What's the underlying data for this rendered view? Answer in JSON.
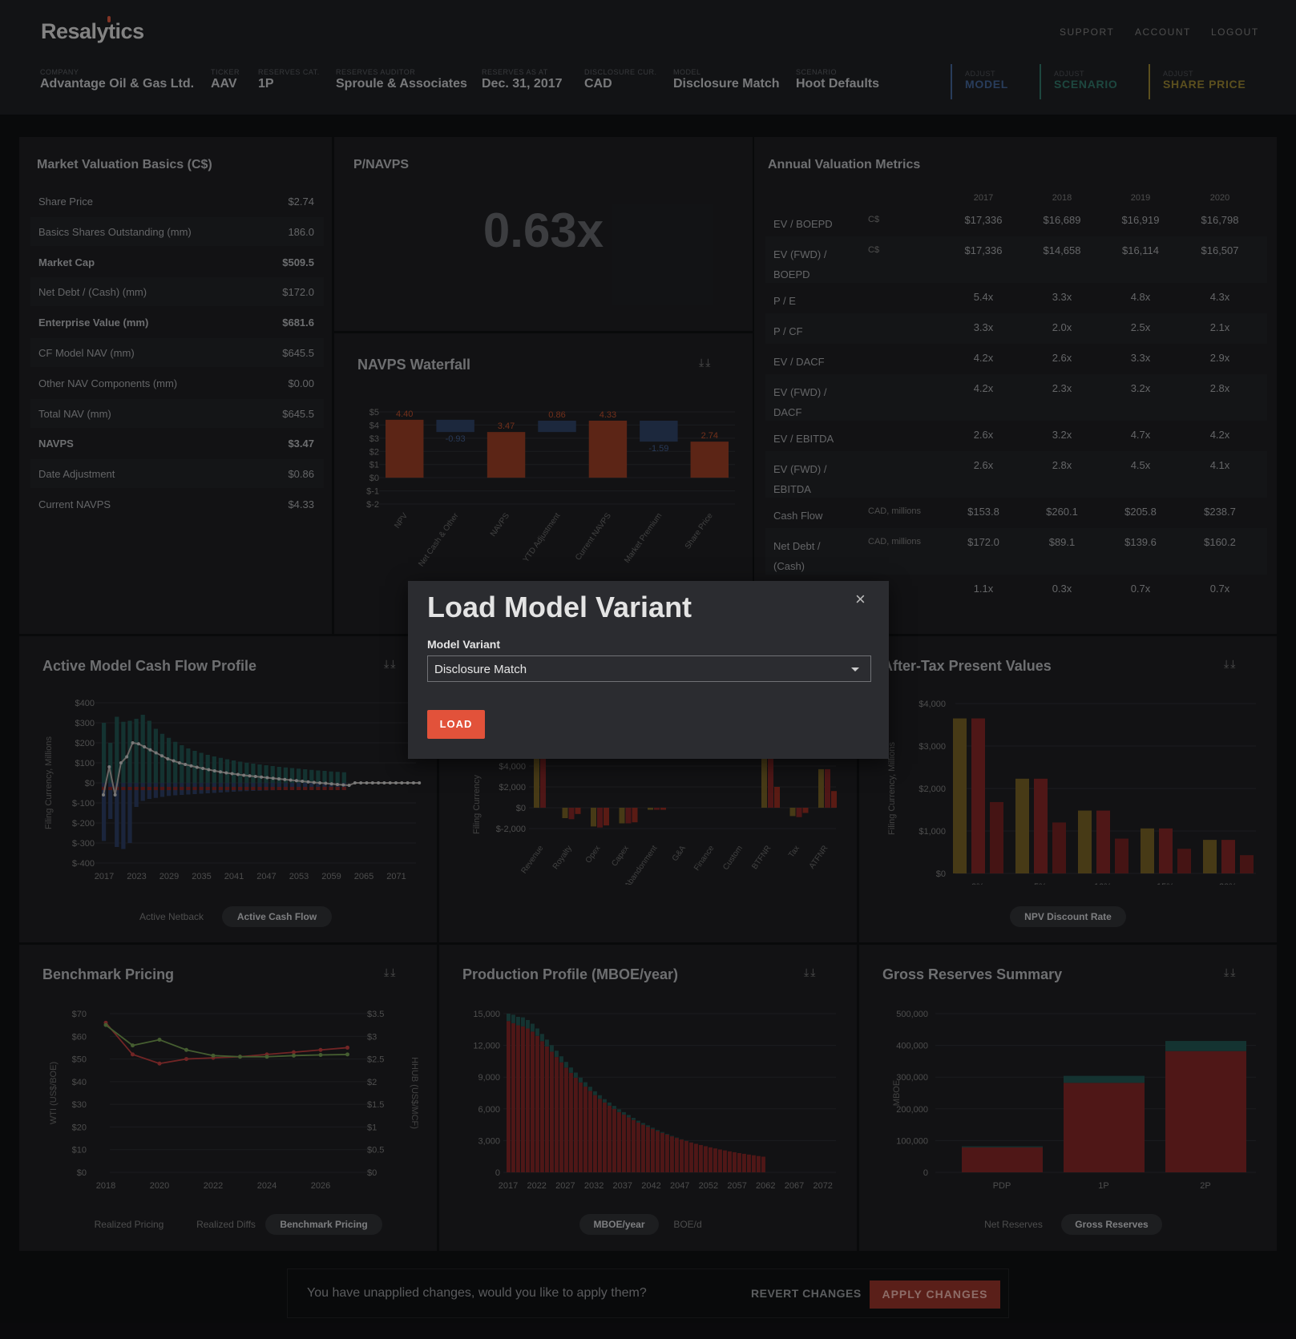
{
  "app": {
    "logo": "Resalytics"
  },
  "topnav": [
    "SUPPORT",
    "ACCOUNT",
    "LOGOUT"
  ],
  "meta": [
    {
      "label": "COMPANY",
      "value": "Advantage Oil & Gas Ltd."
    },
    {
      "label": "TICKER",
      "value": "AAV"
    },
    {
      "label": "RESERVES CAT.",
      "value": "1P"
    },
    {
      "label": "RESERVES AUDITOR",
      "value": "Sproule & Associates"
    },
    {
      "label": "RESERVES AS AT",
      "value": "Dec. 31, 2017"
    },
    {
      "label": "DISCLOSURE CUR.",
      "value": "CAD"
    },
    {
      "label": "MODEL",
      "value": "Disclosure Match"
    },
    {
      "label": "SCENARIO",
      "value": "Hoot Defaults"
    }
  ],
  "adjust": [
    {
      "label": "ADJUST",
      "value": "MODEL",
      "color": "#3e5d8c"
    },
    {
      "label": "ADJUST",
      "value": "SCENARIO",
      "color": "#2d6e62"
    },
    {
      "label": "ADJUST",
      "value": "SHARE PRICE",
      "color": "#8c7a2e"
    }
  ],
  "market_valuation": {
    "title": "Market Valuation Basics (C$)",
    "rows": [
      {
        "label": "Share Price",
        "value": "$2.74"
      },
      {
        "label": "Basics Shares Outstanding (mm)",
        "value": "186.0"
      },
      {
        "label": "Market Cap",
        "value": "$509.5"
      },
      {
        "label": "Net Debt / (Cash) (mm)",
        "value": "$172.0"
      },
      {
        "label": "Enterprise Value (mm)",
        "value": "$681.6"
      },
      {
        "label": "CF Model NAV (mm)",
        "value": "$645.5"
      },
      {
        "label": "Other NAV Components (mm)",
        "value": "$0.00"
      },
      {
        "label": "Total NAV (mm)",
        "value": "$645.5"
      },
      {
        "label": "NAVPS",
        "value": "$3.47"
      },
      {
        "label": "Date Adjustment",
        "value": "$0.86"
      },
      {
        "label": "Current NAVPS",
        "value": "$4.33"
      }
    ]
  },
  "pnavps": {
    "title": "P/NAVPS",
    "value": "0.63x"
  },
  "annual_metrics": {
    "title": "Annual Valuation Metrics",
    "years": [
      "2017",
      "2018",
      "2019",
      "2020"
    ],
    "rows": [
      {
        "label": "EV / BOEPD",
        "unit": "C$",
        "values": [
          "$17,336",
          "$16,689",
          "$16,919",
          "$16,798"
        ]
      },
      {
        "label": "EV (FWD) / BOEPD",
        "unit": "C$",
        "values": [
          "$17,336",
          "$14,658",
          "$16,114",
          "$16,507"
        ]
      },
      {
        "label": "P / E",
        "unit": "",
        "values": [
          "5.4x",
          "3.3x",
          "4.8x",
          "4.3x"
        ]
      },
      {
        "label": "P / CF",
        "unit": "",
        "values": [
          "3.3x",
          "2.0x",
          "2.5x",
          "2.1x"
        ]
      },
      {
        "label": "EV / DACF",
        "unit": "",
        "values": [
          "4.2x",
          "2.6x",
          "3.3x",
          "2.9x"
        ]
      },
      {
        "label": "EV (FWD) / DACF",
        "unit": "",
        "values": [
          "4.2x",
          "2.3x",
          "3.2x",
          "2.8x"
        ]
      },
      {
        "label": "EV / EBITDA",
        "unit": "",
        "values": [
          "2.6x",
          "3.2x",
          "4.7x",
          "4.2x"
        ]
      },
      {
        "label": "EV (FWD) / EBITDA",
        "unit": "",
        "values": [
          "2.6x",
          "2.8x",
          "4.5x",
          "4.1x"
        ]
      },
      {
        "label": "Cash Flow",
        "unit": "CAD, millions",
        "values": [
          "$153.8",
          "$260.1",
          "$205.8",
          "$238.7"
        ]
      },
      {
        "label": "Net Debt / (Cash)",
        "unit": "CAD, millions",
        "values": [
          "$172.0",
          "$89.1",
          "$139.6",
          "$160.2"
        ]
      },
      {
        "label": "",
        "unit": "",
        "values": [
          "1.1x",
          "0.3x",
          "0.7x",
          "0.7x"
        ]
      }
    ]
  },
  "panels": {
    "navps_waterfall": "NAVPS Waterfall",
    "cash_flow": "Active Model Cash Flow Profile",
    "after_tax": "After-Tax Present Values",
    "benchmark": "Benchmark Pricing",
    "production": "Production Profile (MBOE/year)",
    "reserves": "Gross Reserves Summary"
  },
  "download_icons": "⤓⤓",
  "pills": {
    "cash_flow": [
      "Active Netback",
      "Active Cash Flow"
    ],
    "after_tax": [
      "NPV Discount Rate"
    ],
    "benchmark": [
      "Realized Pricing",
      "Realized Diffs",
      "Benchmark Pricing"
    ],
    "production": [
      "MBOE/year",
      "BOE/d"
    ],
    "reserves": [
      "Net Reserves",
      "Gross Reserves"
    ]
  },
  "modal": {
    "title": "Load Model Variant",
    "field_label": "Model Variant",
    "selected": "Disclosure Match",
    "button": "LOAD",
    "close": "×"
  },
  "bottom_bar": {
    "message": "You have unapplied changes, would you like to apply them?",
    "revert": "REVERT CHANGES",
    "apply": "APPLY CHANGES"
  },
  "chart_data": [
    {
      "id": "navps_waterfall",
      "type": "bar",
      "categories": [
        "NPV",
        "Net Cash & Other",
        "NAVPS",
        "YTD Adjustment",
        "Current NAVPS",
        "Market Premium",
        "Share Price"
      ],
      "values": [
        4.4,
        -0.93,
        3.47,
        0.86,
        4.33,
        -1.59,
        2.74
      ],
      "labels": [
        "4.40",
        "-0.93",
        "3.47",
        "0.86",
        "4.33",
        "-1.59",
        "2.74"
      ],
      "kind": [
        "total",
        "delta",
        "total",
        "delta",
        "total",
        "delta",
        "total"
      ],
      "ylabel": "",
      "yticks": [
        "$5",
        "$4",
        "$3",
        "$2",
        "$1",
        "$0",
        "$-1",
        "$-2"
      ],
      "ylim": [
        -2,
        5
      ],
      "colors": {
        "total": "#8e3a22",
        "delta": "#2c3e5e"
      }
    },
    {
      "id": "cash_flow",
      "type": "bar",
      "ylabel": "Filing Currency, Millions",
      "xticks": [
        "2017",
        "2023",
        "2029",
        "2035",
        "2041",
        "2047",
        "2053",
        "2059",
        "2065",
        "2071"
      ],
      "yticks": [
        "$400",
        "$300",
        "$200",
        "$100",
        "$0",
        "$-100",
        "$-200",
        "$-300",
        "$-400"
      ],
      "ylim": [
        -400,
        400
      ],
      "series": [
        {
          "name": "Revenue",
          "color": "#1f4f4c",
          "values": [
            300,
            200,
            330,
            305,
            310,
            320,
            340,
            310,
            270,
            245,
            225,
            205,
            188,
            172,
            160,
            150,
            140,
            132,
            125,
            118,
            112,
            106,
            101,
            96,
            92,
            88,
            84,
            80,
            77,
            74,
            71,
            68,
            65,
            62,
            60,
            57,
            55,
            53
          ]
        },
        {
          "name": "Costs",
          "color": "#2a3a5c",
          "values": [
            -290,
            -180,
            -320,
            -330,
            -300,
            -120,
            -90,
            -80,
            -75,
            -70,
            -65,
            -62,
            -60,
            -58,
            -56,
            -54,
            -52,
            -50,
            -48,
            -46,
            -44,
            -42,
            -41,
            -40,
            -39,
            -38,
            -37,
            -36,
            -35,
            -34,
            -33,
            -32,
            -31,
            -30,
            -29,
            -28,
            -27,
            -26
          ]
        },
        {
          "name": "Cash Flow",
          "color": "#a49d9a",
          "values": [
            -60,
            80,
            -60,
            100,
            130,
            200,
            195,
            180,
            165,
            150,
            135,
            120,
            110,
            100,
            92,
            85,
            78,
            72,
            66,
            60,
            55,
            50,
            46,
            42,
            38,
            35,
            32,
            29,
            26,
            23,
            20,
            17,
            14,
            11,
            8,
            5,
            2,
            0,
            -2,
            -5,
            -8,
            -10,
            -12,
            0,
            0,
            0,
            0,
            0,
            0,
            0,
            0,
            0,
            0,
            0,
            0
          ]
        }
      ]
    },
    {
      "id": "npv_breakdown",
      "type": "bar",
      "categories": [
        "Revenue",
        "Royalty",
        "Opex",
        "Capex",
        "Abandonment",
        "G&A",
        "Finance",
        "Custom",
        "BTFNR",
        "Tax",
        "ATFNR"
      ],
      "yticks": [
        "$4,000",
        "$2,000",
        "$0",
        "$-2,000"
      ],
      "ylim": [
        -2000,
        4000
      ],
      "ylabel": "Filing Currency",
      "series": [
        {
          "color": "#6e5a22",
          "values": [
            4800,
            -1000,
            -1800,
            -1500,
            -200,
            0,
            0,
            0,
            4700,
            -800,
            3700
          ]
        },
        {
          "color": "#7a2424",
          "values": [
            4800,
            -1100,
            -1900,
            -1500,
            -200,
            0,
            0,
            0,
            4700,
            -900,
            3700
          ]
        },
        {
          "color": "#8a2a1f",
          "values": [
            0,
            -600,
            -1700,
            -1400,
            -200,
            0,
            0,
            0,
            2000,
            -500,
            1600
          ]
        }
      ]
    },
    {
      "id": "after_tax",
      "type": "bar",
      "categories": [
        "0%",
        "5%",
        "10%",
        "15%",
        "20%"
      ],
      "yticks": [
        "$4,000",
        "$3,000",
        "$2,000",
        "$1,000",
        "$0"
      ],
      "ylim": [
        0,
        4000
      ],
      "ylabel": "Filing Currency, Millions",
      "series": [
        {
          "color": "#6e5a22",
          "values": [
            3650,
            2230,
            1480,
            1060,
            790
          ]
        },
        {
          "color": "#7a2424",
          "values": [
            3650,
            2230,
            1480,
            1060,
            790
          ]
        },
        {
          "color": "#6b1f1f",
          "values": [
            1680,
            1200,
            820,
            580,
            430
          ]
        }
      ]
    },
    {
      "id": "benchmark",
      "type": "line",
      "x": [
        2018,
        2019,
        2020,
        2021,
        2022,
        2023,
        2024,
        2025,
        2026,
        2027
      ],
      "xticks": [
        "2018",
        "2020",
        "2022",
        "2024",
        "2026"
      ],
      "yticks_left": [
        "$70",
        "$60",
        "$50",
        "$40",
        "$30",
        "$20",
        "$10",
        "$0"
      ],
      "yticks_right": [
        "$3.5",
        "$3",
        "$2.5",
        "$2",
        "$1.5",
        "$1",
        "$0.5",
        "$0"
      ],
      "ylabel_left": "WTI (US$/BOE)",
      "ylabel_right": "HHUB (US$/MCF)",
      "ylim_left": [
        0,
        70
      ],
      "ylim_right": [
        0,
        3.5
      ],
      "series": [
        {
          "axis": "left",
          "color": "#b03a3a",
          "values": [
            66,
            52,
            48,
            50,
            50.5,
            51,
            52,
            53,
            54,
            55
          ]
        },
        {
          "axis": "left",
          "color": "#6b8f4a",
          "values": [
            65,
            56,
            58.5,
            54,
            51.5,
            51,
            51,
            51.5,
            51.8,
            52
          ]
        }
      ]
    },
    {
      "id": "production",
      "type": "bar",
      "xticks": [
        "2017",
        "2022",
        "2027",
        "2032",
        "2037",
        "2042",
        "2047",
        "2052",
        "2057",
        "2062",
        "2067",
        "2072"
      ],
      "yticks": [
        "15,000",
        "12,000",
        "9,000",
        "6,000",
        "3,000",
        "0"
      ],
      "ylim": [
        0,
        15000
      ],
      "series": [
        {
          "color": "#7a2424",
          "values": [
            14300,
            14100,
            13900,
            13800,
            13600,
            13300,
            12900,
            12400,
            11900,
            11400,
            10900,
            10400,
            9900,
            9400,
            8950,
            8500,
            8100,
            7700,
            7300,
            6950,
            6600,
            6300,
            6000,
            5700,
            5450,
            5200,
            4950,
            4700,
            4500,
            4300,
            4100,
            3900,
            3730,
            3560,
            3400,
            3250,
            3100,
            2960,
            2820,
            2700,
            2580,
            2470,
            2360,
            2260,
            2160,
            2070,
            1980,
            1900,
            1820,
            1750,
            1680,
            1610,
            1540,
            1480
          ]
        },
        {
          "color": "#1f4f4c",
          "values": [
            700,
            800,
            800,
            850,
            800,
            750,
            700,
            680,
            650,
            620,
            600,
            570,
            540,
            510,
            480,
            450,
            420,
            390,
            360,
            340,
            320,
            300,
            280,
            260,
            240,
            220,
            200,
            180,
            160,
            140,
            120,
            100,
            80,
            60,
            50,
            40,
            30,
            20,
            10,
            0,
            0,
            0,
            0,
            0,
            0,
            0,
            0,
            0,
            0,
            0,
            0,
            0,
            0,
            0
          ]
        }
      ]
    },
    {
      "id": "reserves",
      "type": "bar",
      "categories": [
        "PDP",
        "1P",
        "2P"
      ],
      "yticks": [
        "500,000",
        "400,000",
        "300,000",
        "200,000",
        "100,000",
        "0"
      ],
      "ylim": [
        0,
        500000
      ],
      "ylabel": "MBOE",
      "series": [
        {
          "color": "#7a2424",
          "values": [
            79000,
            282000,
            382000
          ]
        },
        {
          "color": "#1f4f4c",
          "values": [
            3000,
            22000,
            32000
          ]
        }
      ]
    }
  ]
}
